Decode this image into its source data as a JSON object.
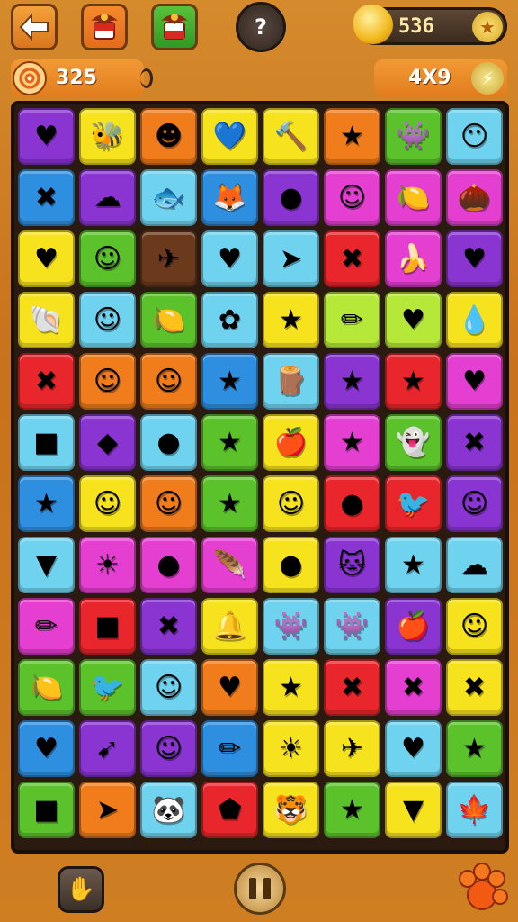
{
  "header": {
    "back_icon": "arrow-left-icon",
    "flag_icons": [
      "eagle-emblem-icon",
      "eagle-emblem-icon"
    ],
    "help_label": "?",
    "coins": "536"
  },
  "subheader": {
    "score": "325",
    "grid_size": "4X9"
  },
  "colors": {
    "red": "#e8262b",
    "orange": "#f07c1c",
    "yellow": "#f7e21e",
    "green": "#5cc22c",
    "lightblue": "#6fd3ef",
    "blue": "#2e8fe0",
    "purple": "#8a34d1",
    "magenta": "#e43fd1",
    "lime": "#b6e83a",
    "brown": "#6b3a1c",
    "pink": "#ff6fb5"
  },
  "board": {
    "rows": 12,
    "cols": 8,
    "tiles": [
      [
        {
          "c": "purple",
          "i": "♥",
          "k": "heart"
        },
        {
          "c": "yellow",
          "i": "🐝",
          "k": "bee"
        },
        {
          "c": "orange",
          "i": "☻",
          "k": "blob"
        },
        {
          "c": "yellow",
          "i": "💙",
          "k": "heart"
        },
        {
          "c": "yellow",
          "i": "🔨",
          "k": "hammer"
        },
        {
          "c": "orange",
          "i": "★",
          "k": "star"
        },
        {
          "c": "green",
          "i": "👾",
          "k": "creature"
        },
        {
          "c": "lightblue",
          "i": "😶",
          "k": "blob"
        }
      ],
      [
        {
          "c": "blue",
          "i": "✖",
          "k": "cross"
        },
        {
          "c": "purple",
          "i": "☁",
          "k": "cloud"
        },
        {
          "c": "lightblue",
          "i": "🐟",
          "k": "fish"
        },
        {
          "c": "blue",
          "i": "🦊",
          "k": "fox"
        },
        {
          "c": "purple",
          "i": "●",
          "k": "ball"
        },
        {
          "c": "magenta",
          "i": "☺",
          "k": "blob"
        },
        {
          "c": "magenta",
          "i": "🍋",
          "k": "lemon"
        },
        {
          "c": "magenta",
          "i": "🌰",
          "k": "nut"
        }
      ],
      [
        {
          "c": "yellow",
          "i": "♥",
          "k": "heart"
        },
        {
          "c": "green",
          "i": "☺",
          "k": "blob"
        },
        {
          "c": "brown",
          "i": "✈",
          "k": "plane"
        },
        {
          "c": "lightblue",
          "i": "♥",
          "k": "heart"
        },
        {
          "c": "lightblue",
          "i": "➤",
          "k": "arrow"
        },
        {
          "c": "red",
          "i": "✖",
          "k": "cross"
        },
        {
          "c": "magenta",
          "i": "🍌",
          "k": "banana"
        },
        {
          "c": "purple",
          "i": "♥",
          "k": "heart"
        }
      ],
      [
        {
          "c": "yellow",
          "i": "🐚",
          "k": "shell"
        },
        {
          "c": "lightblue",
          "i": "☺",
          "k": "blob"
        },
        {
          "c": "green",
          "i": "🍋",
          "k": "lemon"
        },
        {
          "c": "lightblue",
          "i": "✿",
          "k": "flower"
        },
        {
          "c": "yellow",
          "i": "★",
          "k": "star"
        },
        {
          "c": "lime",
          "i": "✏",
          "k": "pencil"
        },
        {
          "c": "lime",
          "i": "♥",
          "k": "heart"
        },
        {
          "c": "yellow",
          "i": "💧",
          "k": "drop"
        }
      ],
      [
        {
          "c": "red",
          "i": "✖",
          "k": "cross"
        },
        {
          "c": "orange",
          "i": "☺",
          "k": "blob"
        },
        {
          "c": "orange",
          "i": "☺",
          "k": "blob"
        },
        {
          "c": "blue",
          "i": "★",
          "k": "star"
        },
        {
          "c": "lightblue",
          "i": "🪵",
          "k": "log"
        },
        {
          "c": "purple",
          "i": "★",
          "k": "star"
        },
        {
          "c": "red",
          "i": "★",
          "k": "star"
        },
        {
          "c": "magenta",
          "i": "♥",
          "k": "heart"
        }
      ],
      [
        {
          "c": "lightblue",
          "i": "■",
          "k": "cube"
        },
        {
          "c": "purple",
          "i": "◆",
          "k": "gem"
        },
        {
          "c": "lightblue",
          "i": "●",
          "k": "ball"
        },
        {
          "c": "green",
          "i": "★",
          "k": "star"
        },
        {
          "c": "yellow",
          "i": "🍎",
          "k": "apple"
        },
        {
          "c": "magenta",
          "i": "★",
          "k": "star"
        },
        {
          "c": "green",
          "i": "👻",
          "k": "ghost"
        },
        {
          "c": "purple",
          "i": "✖",
          "k": "cross"
        }
      ],
      [
        {
          "c": "blue",
          "i": "★",
          "k": "star"
        },
        {
          "c": "yellow",
          "i": "☺",
          "k": "blob"
        },
        {
          "c": "orange",
          "i": "☺",
          "k": "blob"
        },
        {
          "c": "green",
          "i": "★",
          "k": "star"
        },
        {
          "c": "yellow",
          "i": "☺",
          "k": "blob"
        },
        {
          "c": "red",
          "i": "●",
          "k": "ball"
        },
        {
          "c": "red",
          "i": "🐦",
          "k": "bird"
        },
        {
          "c": "purple",
          "i": "☺",
          "k": "face"
        }
      ],
      [
        {
          "c": "lightblue",
          "i": "▼",
          "k": "triangle"
        },
        {
          "c": "magenta",
          "i": "☀",
          "k": "sun"
        },
        {
          "c": "magenta",
          "i": "●",
          "k": "ball"
        },
        {
          "c": "magenta",
          "i": "🪶",
          "k": "feather"
        },
        {
          "c": "yellow",
          "i": "●",
          "k": "ball"
        },
        {
          "c": "purple",
          "i": "🐱",
          "k": "cat"
        },
        {
          "c": "lightblue",
          "i": "★",
          "k": "star"
        },
        {
          "c": "lightblue",
          "i": "☁",
          "k": "cloud"
        }
      ],
      [
        {
          "c": "magenta",
          "i": "✏",
          "k": "pencil"
        },
        {
          "c": "red",
          "i": "■",
          "k": "cube"
        },
        {
          "c": "purple",
          "i": "✖",
          "k": "cross"
        },
        {
          "c": "yellow",
          "i": "🔔",
          "k": "bell"
        },
        {
          "c": "lightblue",
          "i": "👾",
          "k": "creature"
        },
        {
          "c": "lightblue",
          "i": "👾",
          "k": "creature"
        },
        {
          "c": "purple",
          "i": "🍎",
          "k": "apple"
        },
        {
          "c": "yellow",
          "i": "☺",
          "k": "blob"
        }
      ],
      [
        {
          "c": "green",
          "i": "🍋",
          "k": "lemon"
        },
        {
          "c": "green",
          "i": "🐦",
          "k": "bird"
        },
        {
          "c": "lightblue",
          "i": "☺",
          "k": "blob"
        },
        {
          "c": "orange",
          "i": "♥",
          "k": "heart"
        },
        {
          "c": "yellow",
          "i": "★",
          "k": "star"
        },
        {
          "c": "red",
          "i": "✖",
          "k": "cross"
        },
        {
          "c": "magenta",
          "i": "✖",
          "k": "cross"
        },
        {
          "c": "yellow",
          "i": "✖",
          "k": "cross"
        }
      ],
      [
        {
          "c": "blue",
          "i": "♥",
          "k": "heart"
        },
        {
          "c": "purple",
          "i": "➹",
          "k": "arrow"
        },
        {
          "c": "purple",
          "i": "☺",
          "k": "face"
        },
        {
          "c": "blue",
          "i": "✏",
          "k": "pencil"
        },
        {
          "c": "yellow",
          "i": "☀",
          "k": "sun"
        },
        {
          "c": "yellow",
          "i": "✈",
          "k": "plane"
        },
        {
          "c": "lightblue",
          "i": "♥",
          "k": "heart"
        },
        {
          "c": "green",
          "i": "★",
          "k": "star"
        }
      ],
      [
        {
          "c": "green",
          "i": "■",
          "k": "cube"
        },
        {
          "c": "orange",
          "i": "➤",
          "k": "arrow"
        },
        {
          "c": "lightblue",
          "i": "🐼",
          "k": "panda"
        },
        {
          "c": "red",
          "i": "⬟",
          "k": "pentagon"
        },
        {
          "c": "yellow",
          "i": "🐯",
          "k": "tiger"
        },
        {
          "c": "green",
          "i": "★",
          "k": "star"
        },
        {
          "c": "yellow",
          "i": "▼",
          "k": "triangle"
        },
        {
          "c": "lightblue",
          "i": "🍁",
          "k": "leaf"
        }
      ]
    ]
  },
  "footer": {
    "hint_icon": "lightbulb-icon",
    "pause_icon": "pause-icon",
    "paw_icon": "paw-icon"
  }
}
